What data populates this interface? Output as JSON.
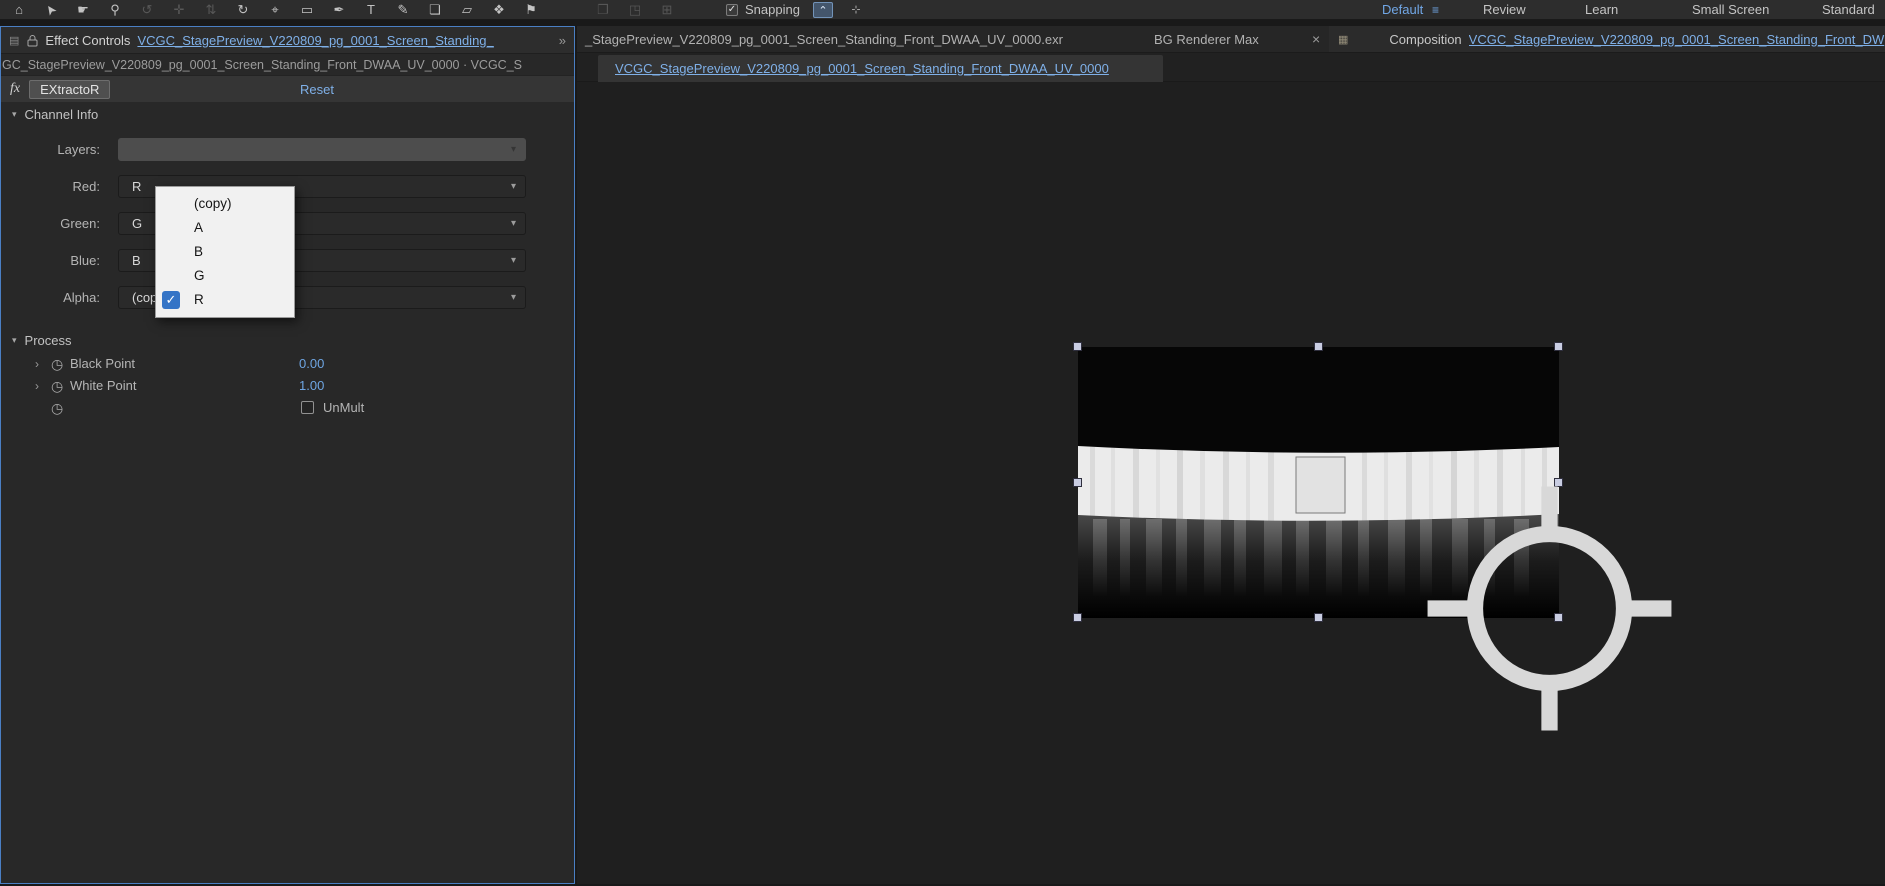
{
  "colors": {
    "accent_blue": "#4a7fc4",
    "link_blue": "#7fb0e8",
    "value_blue": "#6ea5e2",
    "check_blue": "#3474c6",
    "workspace_active": "#71a7e6"
  },
  "glyphs": {
    "dropdown_arrow": "▾",
    "twirl_open": "▾",
    "twirl_closed": "›",
    "stopwatch": "◷",
    "check": "✓",
    "panel_grip": "▤",
    "overflow": "»",
    "menu": "≡"
  },
  "toolbar": {
    "tools": [
      {
        "name": "home",
        "glyph": "⌂"
      },
      {
        "name": "selection",
        "glyph": "➤"
      },
      {
        "name": "hand",
        "glyph": "☛"
      },
      {
        "name": "zoom",
        "glyph": "⚲"
      },
      {
        "name": "orbit-camera",
        "glyph": "↺"
      },
      {
        "name": "track-xy-camera",
        "glyph": "✛"
      },
      {
        "name": "track-z-camera",
        "glyph": "⇅"
      },
      {
        "name": "rotation",
        "glyph": "↻"
      },
      {
        "name": "pan-behind",
        "glyph": "⌖"
      },
      {
        "name": "rectangle",
        "glyph": "▭"
      },
      {
        "name": "pen",
        "glyph": "✒"
      },
      {
        "name": "type",
        "glyph": "T"
      },
      {
        "name": "brush",
        "glyph": "✎"
      },
      {
        "name": "clone-stamp",
        "glyph": "❏"
      },
      {
        "name": "eraser",
        "glyph": "▱"
      },
      {
        "name": "roto-brush",
        "glyph": "❖"
      },
      {
        "name": "puppet-pin",
        "glyph": "⚑"
      }
    ],
    "extra_tools": [
      {
        "glyph": "❐"
      },
      {
        "glyph": "◳"
      },
      {
        "glyph": "⊞"
      }
    ],
    "snapping_label": "Snapping",
    "snap_option_1": "⌃",
    "snap_option_2": "⊹",
    "workspaces": [
      "Default",
      "Review",
      "Learn",
      "Small Screen",
      "Standard"
    ]
  },
  "effect_controls": {
    "panel_tab": "Effect Controls",
    "panel_tab_link": "VCGC_StagePreview_V220809_pg_0001_Screen_Standing_",
    "source_line": "GC_StagePreview_V220809_pg_0001_Screen_Standing_Front_DWAA_UV_0000 · VCGC_S",
    "effect": {
      "badge": "fx",
      "name": "EXtractoR",
      "reset": "Reset"
    },
    "channel_info": {
      "label": "Channel Info",
      "rows": [
        {
          "label": "Layers:",
          "value": ""
        },
        {
          "label": "Red:",
          "value": "R"
        },
        {
          "label": "Green:",
          "value": "G"
        },
        {
          "label": "Blue:",
          "value": "B"
        },
        {
          "label": "Alpha:",
          "value": "(cop"
        }
      ]
    },
    "dropdown_menu": {
      "items": [
        "(copy)",
        "A",
        "B",
        "G",
        "R"
      ],
      "selected": "R"
    },
    "process": {
      "label": "Process",
      "params": [
        {
          "label": "Black Point",
          "value": "0.00"
        },
        {
          "label": "White Point",
          "value": "1.00"
        }
      ],
      "unmult_label": "UnMult"
    }
  },
  "viewer": {
    "footage_tab": "_StagePreview_V220809_pg_0001_Screen_Standing_Front_DWAA_UV_0000.exr",
    "renderer_tab": "BG Renderer Max",
    "close_glyph": "×",
    "grip_glyph": "▦",
    "composition_panel_label": "Composition",
    "composition_panel_link": "VCGC_StagePreview_V220809_pg_0001_Screen_Standing_Front_DW",
    "composition_tab": "VCGC_StagePreview_V220809_pg_0001_Screen_Standing_Front_DWAA_UV_0000"
  }
}
